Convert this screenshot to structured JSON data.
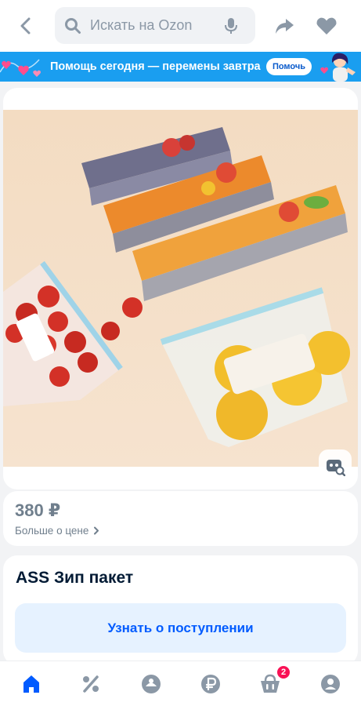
{
  "search": {
    "placeholder": "Искать на Ozon"
  },
  "banner": {
    "text": "Помощь сегодня — перемены завтра",
    "button": "Помочь"
  },
  "product": {
    "price": "380 ₽",
    "price_more": "Больше о цене",
    "title": "ASS Зип пакет",
    "notify_button": "Узнать о поступлении"
  },
  "bottom_nav": {
    "items": [
      "home-icon",
      "percent-icon",
      "fresh-icon",
      "ruble-icon",
      "cart-icon",
      "profile-icon"
    ],
    "cart_badge": "2"
  },
  "colors": {
    "accent": "#005bff",
    "banner": "#1a9ef0",
    "badge": "#f91155",
    "muted_text": "#707f8d",
    "nav_icon": "#8b98a6",
    "nav_active": "#005bff"
  }
}
